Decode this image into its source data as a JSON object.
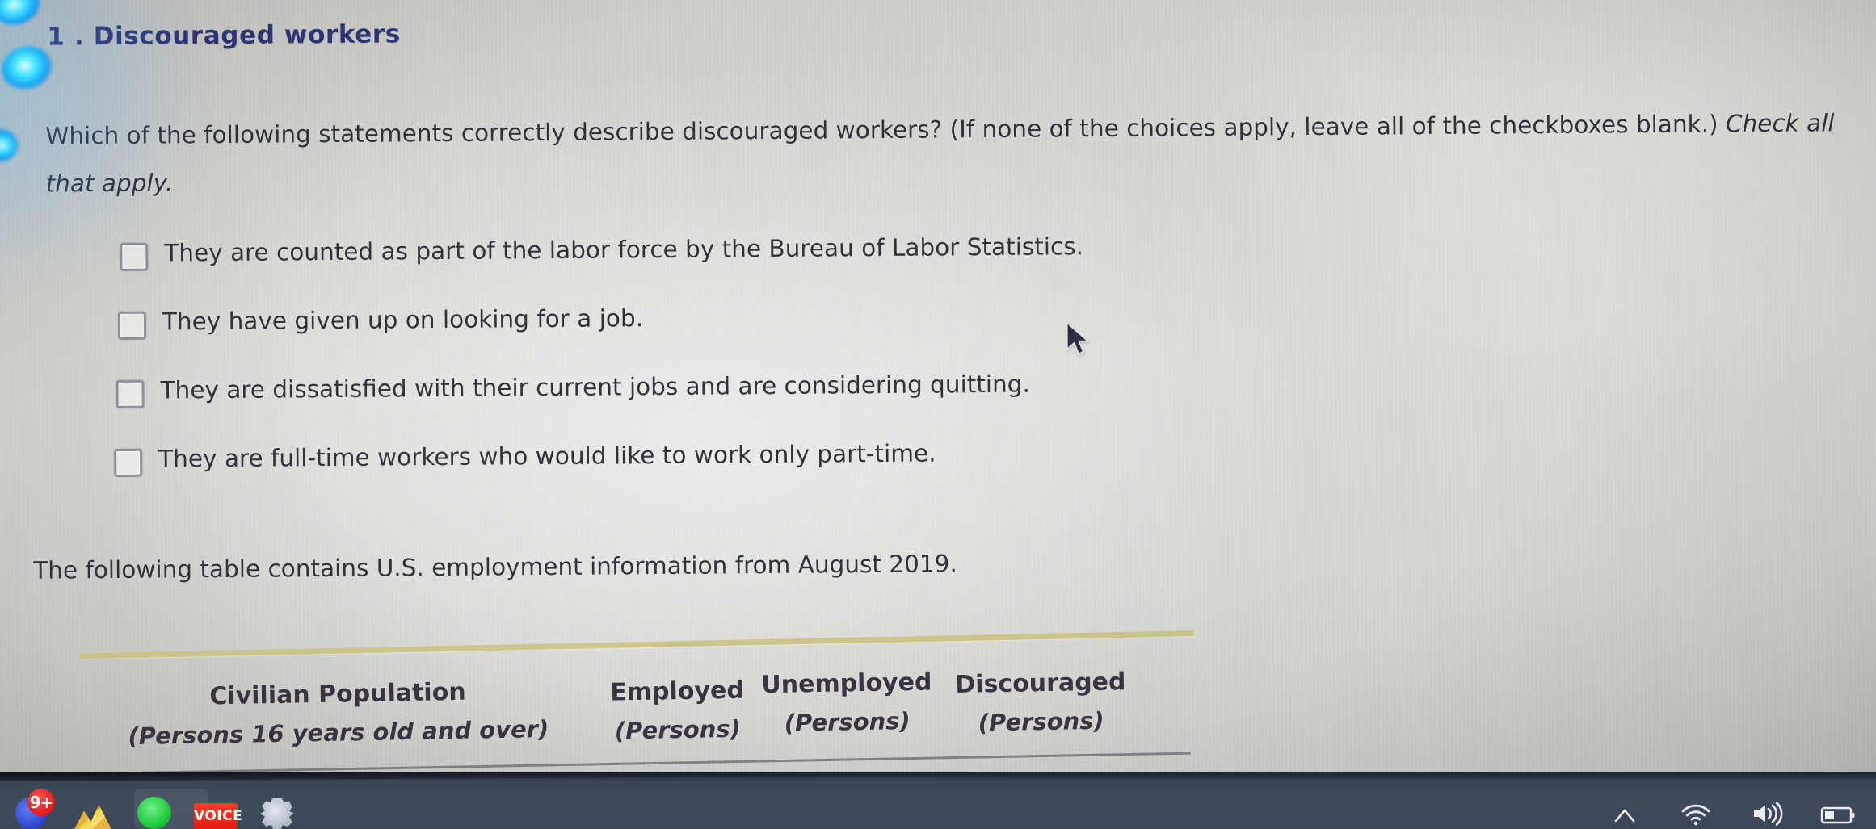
{
  "question": {
    "number_label": "1 . Discouraged workers",
    "prompt_plain": "Which of the following statements correctly describe discouraged workers? (If none of the choices apply, leave all of the checkboxes blank.)",
    "prompt_emphasis": "Check all that apply.",
    "options": [
      {
        "label": "They are counted as part of the labor force by the Bureau of Labor Statistics.",
        "checked": false
      },
      {
        "label": "They have given up on looking for a job.",
        "checked": false
      },
      {
        "label": "They are dissatisfied with their current jobs and are considering quitting.",
        "checked": false
      },
      {
        "label": "They are full-time workers who would like to work only part-time.",
        "checked": false
      }
    ]
  },
  "table_intro": "The following table contains U.S. employment information from August 2019.",
  "employment_table": {
    "columns": [
      {
        "main": "Civilian Population",
        "sub": "(Persons 16 years old and over)"
      },
      {
        "main": "Employed",
        "sub": "(Persons)"
      },
      {
        "main": "Unemployed",
        "sub": "(Persons)"
      },
      {
        "main": "Discouraged",
        "sub": "(Persons)"
      }
    ],
    "rule_color": "#cbc489"
  },
  "taskbar": {
    "apps": [
      {
        "name": "chat-app",
        "badge": "9+"
      },
      {
        "name": "art-app",
        "badge": ""
      },
      {
        "name": "green-app",
        "badge": ""
      },
      {
        "name": "voice-app",
        "badge": "VOICE"
      },
      {
        "name": "settings-app",
        "badge": ""
      }
    ],
    "tray": [
      "show-hidden-icons",
      "wifi",
      "volume",
      "battery"
    ]
  },
  "colors": {
    "title": "#2d3472",
    "body_text": "#2e3138",
    "screen_bg": "#d4d5d1",
    "taskbar_bg": "#3f4a5b",
    "led_blue": "#15b0f7"
  }
}
